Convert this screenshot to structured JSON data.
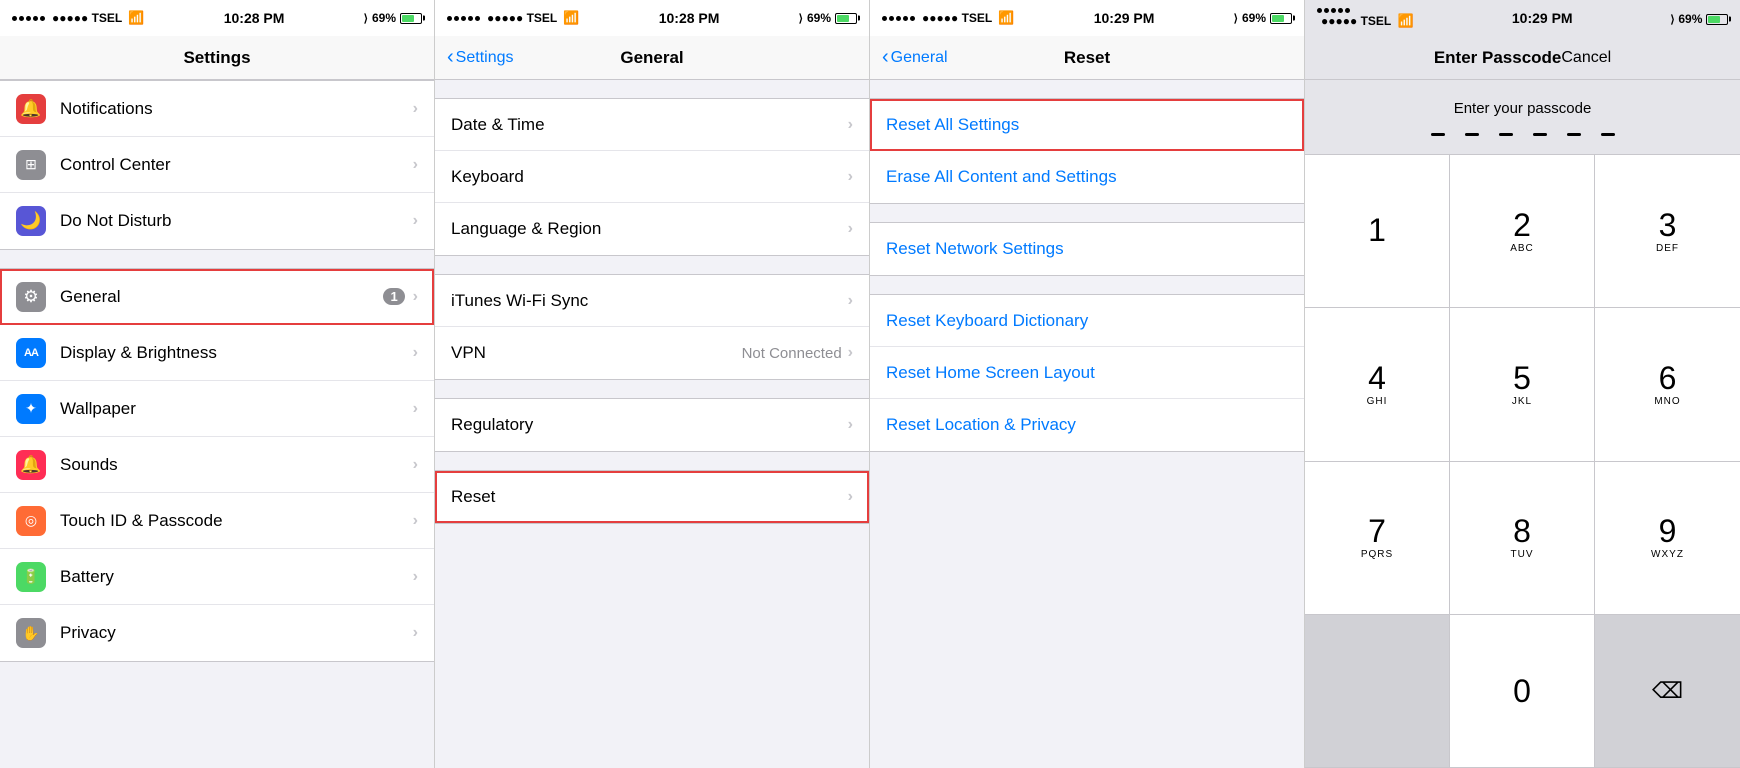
{
  "panels": {
    "settings": {
      "status": {
        "carrier": "●●●●● TSEL",
        "time": "10:28 PM",
        "battery": "69%"
      },
      "title": "Settings",
      "rows": [
        {
          "id": "notifications",
          "icon": "🔔",
          "icon_bg": "icon-red",
          "label": "Notifications",
          "badge": null,
          "value": null
        },
        {
          "id": "control-center",
          "icon": "⊞",
          "icon_bg": "icon-gray",
          "label": "Control Center",
          "badge": null,
          "value": null
        },
        {
          "id": "do-not-disturb",
          "icon": "🌙",
          "icon_bg": "icon-purple",
          "label": "Do Not Disturb",
          "badge": null,
          "value": null
        },
        {
          "id": "general",
          "icon": "⚙",
          "icon_bg": "icon-gray",
          "label": "General",
          "badge": "1",
          "value": null,
          "highlighted": true
        },
        {
          "id": "display-brightness",
          "icon": "AA",
          "icon_bg": "icon-aa",
          "label": "Display & Brightness",
          "badge": null,
          "value": null
        },
        {
          "id": "wallpaper",
          "icon": "❋",
          "icon_bg": "icon-blue",
          "label": "Wallpaper",
          "badge": null,
          "value": null
        },
        {
          "id": "sounds",
          "icon": "🔔",
          "icon_bg": "icon-pink",
          "label": "Sounds",
          "badge": null,
          "value": null
        },
        {
          "id": "touch-id",
          "icon": "◎",
          "icon_bg": "icon-orange",
          "label": "Touch ID & Passcode",
          "badge": null,
          "value": null
        },
        {
          "id": "battery",
          "icon": "🔋",
          "icon_bg": "icon-green",
          "label": "Battery",
          "badge": null,
          "value": null
        },
        {
          "id": "privacy",
          "icon": "✋",
          "icon_bg": "icon-gray",
          "label": "Privacy",
          "badge": null,
          "value": null
        }
      ]
    },
    "general": {
      "status": {
        "carrier": "●●●●● TSEL",
        "time": "10:28 PM",
        "battery": "69%"
      },
      "back_label": "Settings",
      "title": "General",
      "rows": [
        {
          "id": "date-time",
          "label": "Date & Time",
          "value": null
        },
        {
          "id": "keyboard",
          "label": "Keyboard",
          "value": null
        },
        {
          "id": "language-region",
          "label": "Language & Region",
          "value": null
        },
        {
          "id": "itunes-wifi",
          "label": "iTunes Wi-Fi Sync",
          "value": null
        },
        {
          "id": "vpn",
          "label": "VPN",
          "value": "Not Connected"
        },
        {
          "id": "regulatory",
          "label": "Regulatory",
          "value": null
        },
        {
          "id": "reset",
          "label": "Reset",
          "value": null,
          "highlighted": true
        }
      ]
    },
    "reset": {
      "status": {
        "carrier": "●●●●● TSEL",
        "time": "10:29 PM",
        "battery": "69%"
      },
      "back_label": "General",
      "title": "Reset",
      "rows": [
        {
          "id": "reset-all-settings",
          "label": "Reset All Settings",
          "highlighted": true
        },
        {
          "id": "erase-all",
          "label": "Erase All Content and Settings"
        },
        {
          "id": "reset-network",
          "label": "Reset Network Settings"
        },
        {
          "id": "reset-keyboard",
          "label": "Reset Keyboard Dictionary"
        },
        {
          "id": "reset-home-screen",
          "label": "Reset Home Screen Layout"
        },
        {
          "id": "reset-location",
          "label": "Reset Location & Privacy"
        }
      ]
    },
    "passcode": {
      "status": {
        "carrier": "●●●●● TSEL",
        "time": "10:29 PM",
        "battery": "69%"
      },
      "title": "Enter Passcode",
      "cancel_label": "Cancel",
      "prompt": "Enter your passcode",
      "numpad": [
        {
          "number": "1",
          "letters": ""
        },
        {
          "number": "2",
          "letters": "ABC"
        },
        {
          "number": "3",
          "letters": "DEF"
        },
        {
          "number": "4",
          "letters": "GHI"
        },
        {
          "number": "5",
          "letters": "JKL"
        },
        {
          "number": "6",
          "letters": "MNO"
        },
        {
          "number": "7",
          "letters": "PQRS"
        },
        {
          "number": "8",
          "letters": "TUV"
        },
        {
          "number": "9",
          "letters": "WXYZ"
        },
        {
          "number": "",
          "letters": ""
        },
        {
          "number": "0",
          "letters": ""
        },
        {
          "number": "⌫",
          "letters": ""
        }
      ]
    }
  }
}
